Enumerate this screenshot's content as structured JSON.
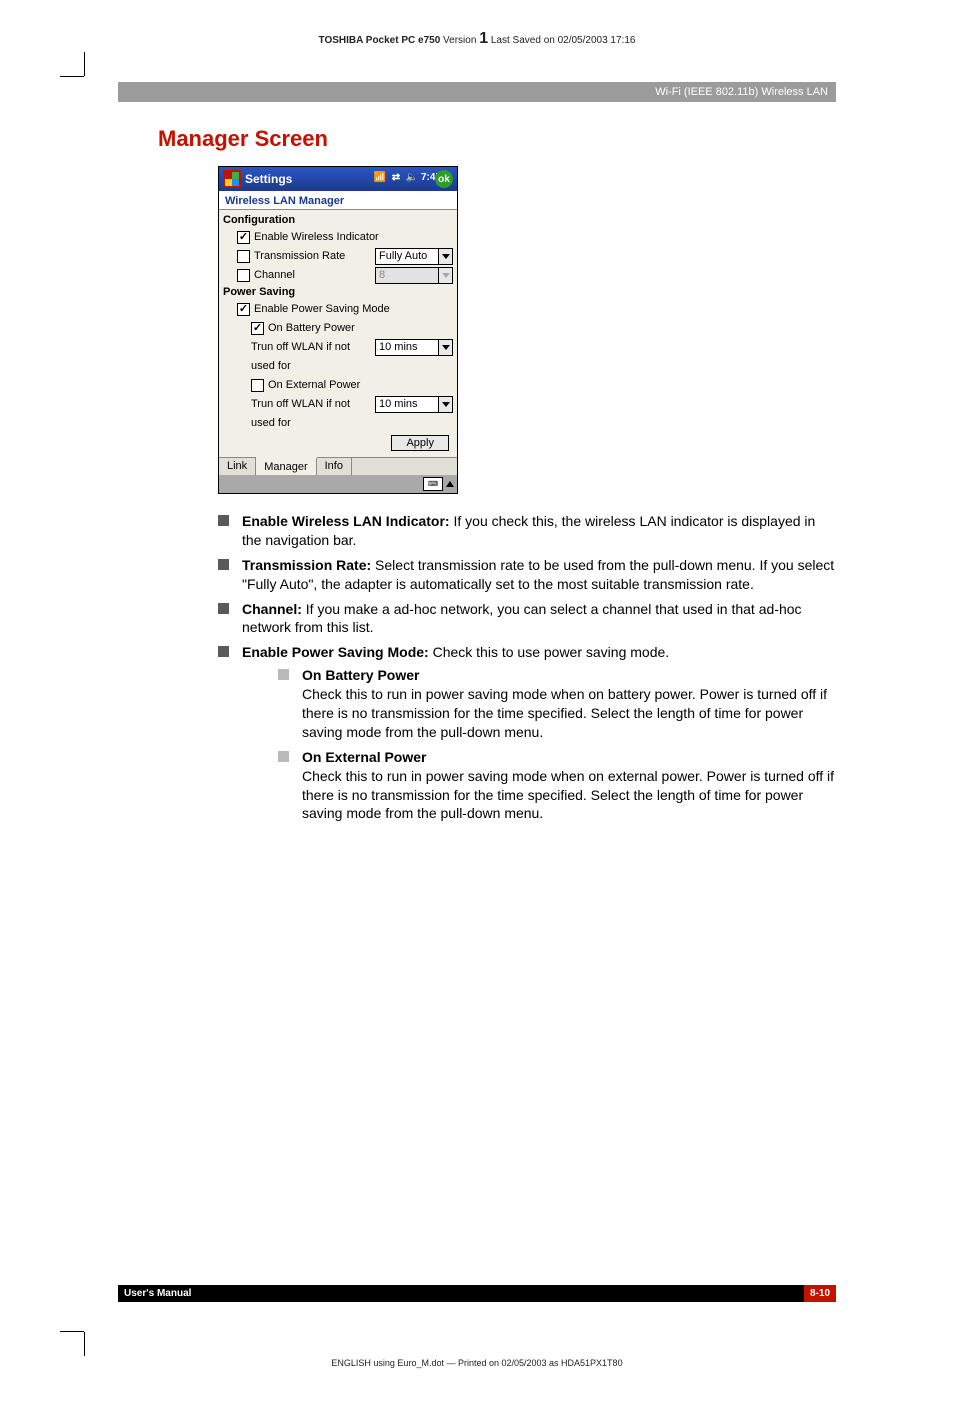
{
  "header": {
    "product": "TOSHIBA Pocket PC e750",
    "version_label": "Version",
    "version_num": "1",
    "saved": "Last Saved on 02/05/2003 17:16"
  },
  "chapter_bar": "Wi-Fi (IEEE 802.11b) Wireless LAN",
  "section_title": "Manager Screen",
  "screenshot": {
    "titlebar": {
      "title": "Settings",
      "icons": {
        "signal": "signal-icon",
        "sync": "sync-icon",
        "volume": "volume-icon"
      },
      "time": "7:45",
      "ok": "ok"
    },
    "app_name": "Wireless LAN Manager",
    "config": {
      "heading": "Configuration",
      "enable_indicator": {
        "label": "Enable Wireless Indicator",
        "checked": true
      },
      "transmission_rate": {
        "label": "Transmission Rate",
        "checked": false,
        "value": "Fully Auto"
      },
      "channel": {
        "label": "Channel",
        "checked": false,
        "value": "8"
      }
    },
    "power": {
      "heading": "Power Saving",
      "enable_psm": {
        "label": "Enable Power Saving Mode",
        "checked": true
      },
      "on_battery": {
        "label": "On Battery Power",
        "checked": true
      },
      "battery_trun": {
        "label_line1": "Trun off WLAN if not",
        "label_line2": "used for",
        "value": "10 mins"
      },
      "on_external": {
        "label": "On External Power",
        "checked": false
      },
      "external_trun": {
        "label_line1": "Trun off WLAN if not",
        "label_line2": "used for",
        "value": "10 mins"
      },
      "apply": "Apply"
    },
    "tabs": {
      "link": "Link",
      "manager": "Manager",
      "info": "Info"
    }
  },
  "bullets": {
    "b1_title": "Enable Wireless LAN Indicator:",
    "b1_text": " If you check this, the wireless LAN indicator is displayed in the navigation bar.",
    "b2_title": "Transmission Rate:",
    "b2_text": " Select transmission rate to be used from the pull-down menu. If you select \"Fully Auto\", the adapter is automatically set to the most suitable transmission rate.",
    "b3_title": "Channel:",
    "b3_text": " If you make a ad-hoc network, you can select a channel that used in that ad-hoc network from this list.",
    "b4_title": "Enable Power Saving Mode:",
    "b4_text": " Check this to use power saving mode.",
    "s1_title": "On Battery Power",
    "s1_text": "Check this to run in power saving mode when on battery power. Power is turned off if there is no transmission for the time specified. Select the length of time for power saving mode from the pull-down menu.",
    "s2_title": "On External Power",
    "s2_text": "Check this to run in power saving mode when on external power. Power is turned off if there is no transmission for the time specified. Select the length of time for power saving mode from the pull-down menu."
  },
  "footer": {
    "left": "User's Manual",
    "page": "8-10"
  },
  "print_line": "ENGLISH using Euro_M.dot — Printed on 02/05/2003 as HDA51PX1T80"
}
